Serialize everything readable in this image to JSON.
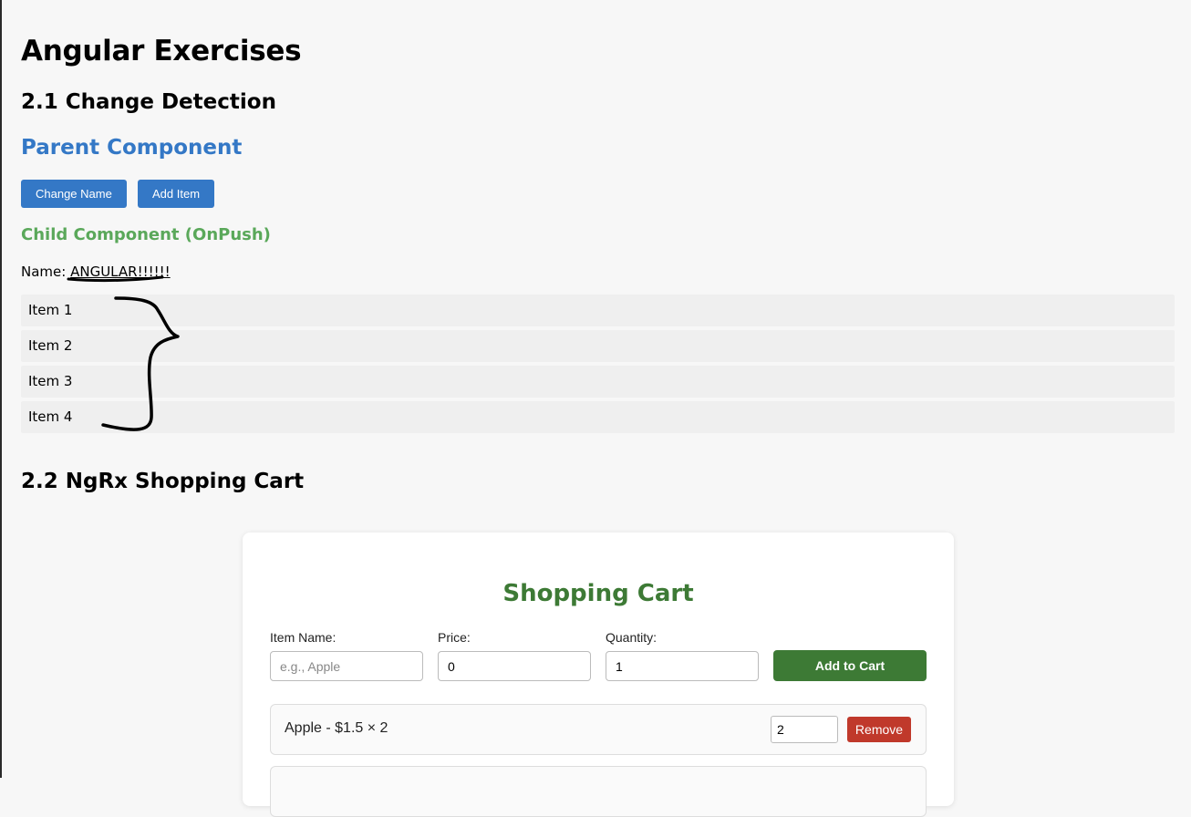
{
  "page": {
    "title": "Angular Exercises"
  },
  "change_detection": {
    "heading": "2.1 Change Detection",
    "parent_title": "Parent Component",
    "buttons": {
      "change_name": "Change Name",
      "add_item": "Add Item"
    },
    "child_title": "Child Component (OnPush)",
    "name_label": "Name:",
    "name_value": "ANGULAR!!!!!!",
    "items": [
      "Item 1",
      "Item 2",
      "Item 3",
      "Item 4"
    ]
  },
  "shopping_cart": {
    "heading": "2.2 NgRx Shopping Cart",
    "title": "Shopping Cart",
    "form": {
      "item_name_label": "Item Name:",
      "item_name_placeholder": "e.g., Apple",
      "price_label": "Price:",
      "price_value": "0",
      "quantity_label": "Quantity:",
      "quantity_value": "1",
      "add_button": "Add to Cart"
    },
    "cart_items": [
      {
        "text": "Apple - $1.5 × 2",
        "quantity": "2",
        "remove_label": "Remove"
      }
    ]
  },
  "colors": {
    "primary_blue": "#3478c6",
    "child_green": "#5aa85a",
    "cart_green": "#3d7a35",
    "remove_red": "#c0392b"
  }
}
